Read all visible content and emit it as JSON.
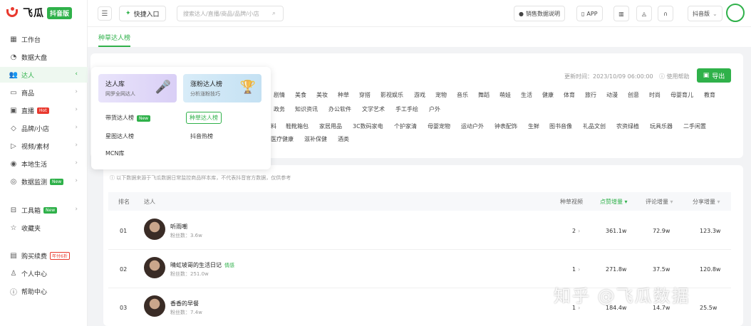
{
  "brand": {
    "name": "飞瓜",
    "badge": "抖音版",
    "color": "#2fb14a",
    "logo_color": "#e9392e"
  },
  "sidebar": {
    "items": [
      {
        "label": "工作台",
        "icon": "grid-icon"
      },
      {
        "label": "数据大盘",
        "icon": "chart-circle-icon"
      },
      {
        "label": "达人",
        "icon": "users-icon",
        "active": true
      },
      {
        "label": "商品",
        "icon": "box-icon"
      },
      {
        "label": "直播",
        "icon": "tv-icon",
        "tag": "Hot"
      },
      {
        "label": "品牌/小店",
        "icon": "tag-icon"
      },
      {
        "label": "视频/素材",
        "icon": "play-icon"
      },
      {
        "label": "本地生活",
        "icon": "location-icon"
      },
      {
        "label": "数据监测",
        "icon": "monitor-icon",
        "tag": "New"
      },
      {
        "label": "工具箱",
        "icon": "toolbox-icon",
        "tag": "New"
      },
      {
        "label": "收藏夹",
        "icon": "star-icon"
      },
      {
        "label": "购买续费",
        "icon": "cart-icon",
        "tag": "年付6折"
      },
      {
        "label": "个人中心",
        "icon": "person-icon"
      },
      {
        "label": "帮助中心",
        "icon": "help-icon"
      }
    ]
  },
  "header": {
    "quick_entry": "快捷入口",
    "search_placeholder": "搜索达人/直播/商品/品牌/小店",
    "sales_doc": "销售数据说明",
    "app": "APP",
    "version": "抖音版"
  },
  "tab": {
    "label": "种草达人榜"
  },
  "toolbar": {
    "update_time": "更新时间：2023/10/09 06:00:00",
    "help": "使用帮助",
    "export": "导出"
  },
  "dropdown": {
    "cards": [
      {
        "title": "达人库",
        "subtitle": "网罗全网达人"
      },
      {
        "title": "涨粉达人榜",
        "subtitle": "分析涨粉技巧"
      }
    ],
    "links": [
      {
        "label": "带货达人榜",
        "tag": "New"
      },
      {
        "label": "种草达人榜",
        "selected": true
      },
      {
        "label": "星图达人榜"
      },
      {
        "label": "抖音热榜"
      },
      {
        "label": "MCN库"
      }
    ]
  },
  "categories": {
    "row1": [
      "剧情",
      "美食",
      "美妆",
      "种草",
      "穿搭",
      "影视娱乐",
      "游戏",
      "宠物",
      "音乐",
      "舞蹈",
      "萌娃",
      "生活",
      "健康",
      "体育",
      "旅行",
      "动漫",
      "创意",
      "时尚",
      "母婴育儿",
      "教育"
    ],
    "row2": [
      "政务",
      "知识资讯",
      "办公软件",
      "文学艺术",
      "手工手绘",
      "户外"
    ],
    "row3": [
      "料",
      "鞋靴箱包",
      "家居用品",
      "3C数码家电",
      "个护家清",
      "母婴宠物",
      "运动户外",
      "钟表配饰",
      "生鲜",
      "图书音像",
      "礼品文创",
      "农资绿植",
      "玩具乐器",
      "二手闲置"
    ],
    "row4": [
      "医疗健康",
      "滋补保健",
      "酒类"
    ]
  },
  "notice": "以下数据来源于飞瓜数据日常监控商品样本库，不代表抖音官方数据，仅供参考",
  "table": {
    "headers": {
      "rank": "排名",
      "influencer": "达人",
      "videos": "种草视频",
      "likes": "点赞增量",
      "comments": "评论增量",
      "shares": "分享增量"
    },
    "rows": [
      {
        "rank": "01",
        "name": "听雨嘲",
        "fans": "粉丝数：3.6w",
        "tag": "",
        "videos": "2",
        "likes": "361.1w",
        "comments": "72.9w",
        "shares": "123.3w"
      },
      {
        "rank": "02",
        "name": "晴虹坡哥的生活日记",
        "fans": "粉丝数：251.0w",
        "tag": "情感",
        "videos": "1",
        "likes": "271.8w",
        "comments": "37.5w",
        "shares": "120.8w"
      },
      {
        "rank": "03",
        "name": "香香的早餐",
        "fans": "粉丝数：7.4w",
        "tag": "",
        "videos": "1",
        "likes": "184.4w",
        "comments": "14.7w",
        "shares": "25.5w"
      }
    ]
  },
  "watermark": "知乎 @飞瓜数据"
}
